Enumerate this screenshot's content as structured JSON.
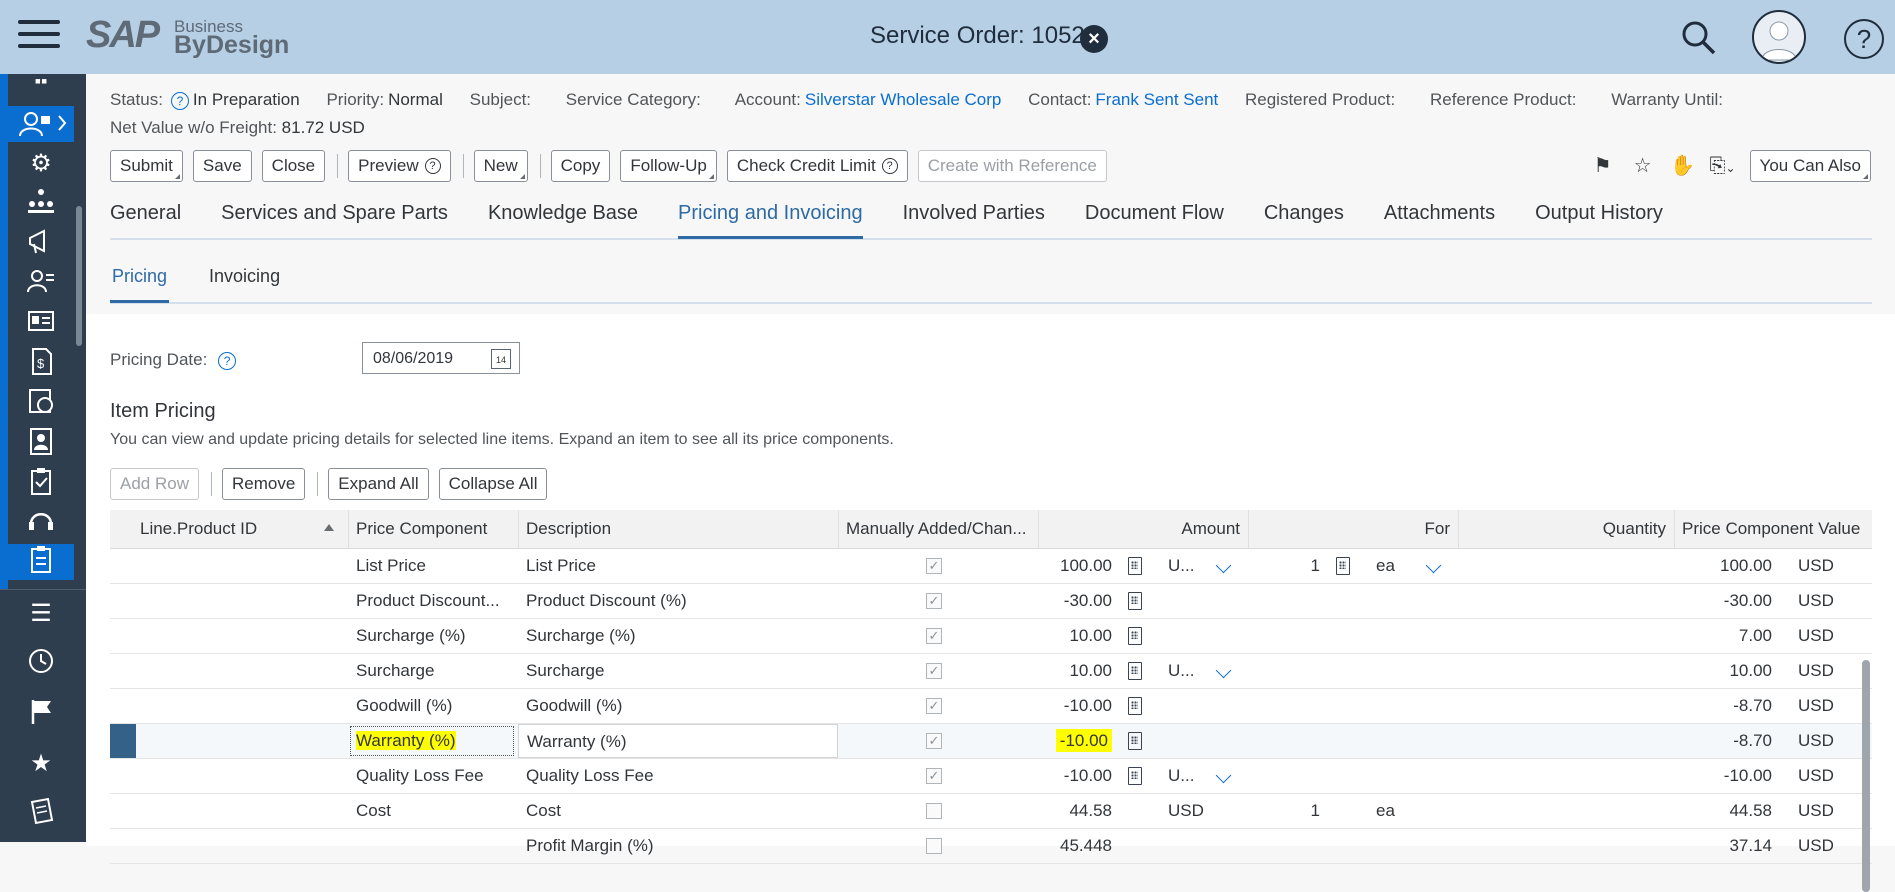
{
  "shell": {
    "logo_main": "SAP",
    "logo_sub1": "Business",
    "logo_sub2": "ByDesign",
    "title": "Service Order: 1052",
    "close_icon": "×",
    "help_icon": "?"
  },
  "header": {
    "status_label": "Status:",
    "status_value": "In Preparation",
    "priority_label": "Priority:",
    "priority_value": "Normal",
    "subject_label": "Subject:",
    "service_category_label": "Service Category:",
    "account_label": "Account:",
    "account_value": "Silverstar Wholesale Corp",
    "contact_label": "Contact:",
    "contact_value": "Frank Sent Sent",
    "registered_product_label": "Registered Product:",
    "reference_product_label": "Reference Product:",
    "warranty_until_label": "Warranty Until:",
    "net_value_label": "Net Value w/o Freight:",
    "net_value": "81.72 USD"
  },
  "toolbar": {
    "submit": "Submit",
    "save": "Save",
    "close": "Close",
    "preview": "Preview",
    "new": "New",
    "copy": "Copy",
    "follow_up": "Follow-Up",
    "check_credit_limit": "Check Credit Limit",
    "create_with_reference": "Create with Reference",
    "you_can_also": "You Can Also"
  },
  "tabs": [
    "General",
    "Services and Spare Parts",
    "Knowledge Base",
    "Pricing and Invoicing",
    "Involved Parties",
    "Document Flow",
    "Changes",
    "Attachments",
    "Output History"
  ],
  "subtabs": [
    "Pricing",
    "Invoicing"
  ],
  "pricing": {
    "date_label": "Pricing Date:",
    "date_value": "08/06/2019",
    "calendar_day": "14",
    "section_title": "Item Pricing",
    "section_desc": "You can view and update pricing details for selected line items. Expand an item to see all its price components.",
    "add_row": "Add Row",
    "remove": "Remove",
    "expand_all": "Expand All",
    "collapse_all": "Collapse All"
  },
  "table": {
    "columns": {
      "line_product_id": "Line.Product ID",
      "price_component": "Price Component",
      "description": "Description",
      "manually": "Manually Added/Chan...",
      "amount": "Amount",
      "for": "For",
      "quantity": "Quantity",
      "pcv": "Price Component Value"
    },
    "rows": [
      {
        "component": "List Price",
        "description": "List Price",
        "checked": true,
        "amount": "100.00",
        "unit": "U...",
        "unit_dd": true,
        "for_qty": "1",
        "for_unit": "ea",
        "for_calc": true,
        "value": "100.00",
        "currency": "USD"
      },
      {
        "component": "Product Discount...",
        "description": "Product Discount (%)",
        "checked": true,
        "amount": "-30.00",
        "unit": "",
        "value": "-30.00",
        "currency": "USD"
      },
      {
        "component": "Surcharge (%)",
        "description": "Surcharge (%)",
        "checked": true,
        "amount": "10.00",
        "unit": "",
        "value": "7.00",
        "currency": "USD"
      },
      {
        "component": "Surcharge",
        "description": "Surcharge",
        "checked": true,
        "amount": "10.00",
        "unit": "U...",
        "unit_dd": true,
        "value": "10.00",
        "currency": "USD"
      },
      {
        "component": "Goodwill (%)",
        "description": "Goodwill (%)",
        "checked": true,
        "amount": "-10.00",
        "unit": "",
        "value": "-8.70",
        "currency": "USD"
      },
      {
        "component": "Warranty (%)",
        "description": "Warranty (%)",
        "checked": true,
        "amount": "-10.00",
        "unit": "",
        "value": "-8.70",
        "currency": "USD",
        "selected": true
      },
      {
        "component": "Quality Loss Fee",
        "description": "Quality Loss Fee",
        "checked": true,
        "amount": "-10.00",
        "unit": "U...",
        "unit_dd": true,
        "value": "-10.00",
        "currency": "USD"
      },
      {
        "component": "Cost",
        "description": "Cost",
        "checked": false,
        "amount": "44.58",
        "unit": "USD",
        "for_qty": "1",
        "for_unit": "ea",
        "value": "44.58",
        "currency": "USD"
      },
      {
        "component": "",
        "description": "Profit Margin (%)",
        "checked": false,
        "amount": "45.448",
        "unit": "",
        "value": "37.14",
        "currency": "USD"
      }
    ]
  },
  "colors": {
    "shell_bg": "#b6cfe5",
    "nav_bg": "#2e3e4e",
    "accent": "#0a6ed1",
    "active_tab": "#2e6aa4",
    "highlight": "#ffff00"
  }
}
